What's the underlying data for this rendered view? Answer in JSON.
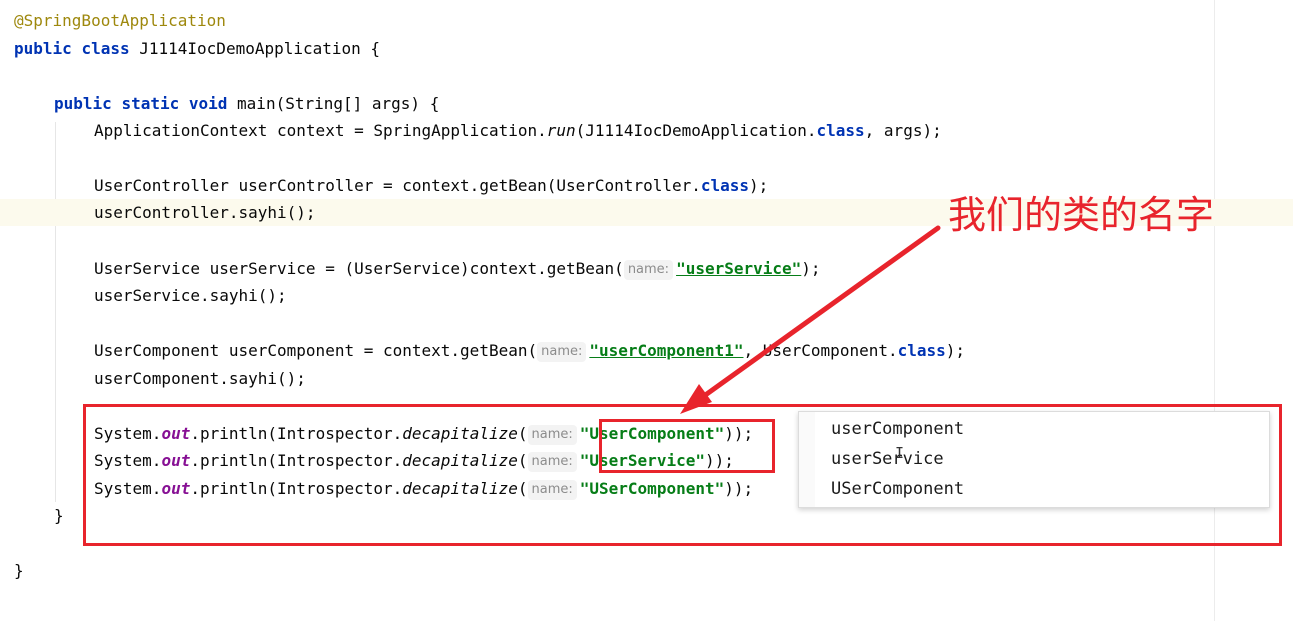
{
  "editor": {
    "lines": {
      "l1": {
        "annotation": "@SpringBootApplication"
      },
      "l2": {
        "kw1": "public",
        "kw2": "class",
        "rest": " J1114IocDemoApplication {"
      },
      "l4": {
        "kw1": "public",
        "kw2": "static",
        "kw3": "void",
        "rest": " main(String[] args) {"
      },
      "l5": {
        "p1": "ApplicationContext context = SpringApplication.",
        "method": "run",
        "p2": "(J1114IocDemoApplication.",
        "kw": "class",
        "p3": ", args);"
      },
      "l7": {
        "p1": "UserController userController = context.getBean(UserController.",
        "kw": "class",
        "p2": ");"
      },
      "l8": {
        "text": "userController.sayhi();"
      },
      "l10": {
        "p1": "UserService userService = (UserService)context.getBean(",
        "hint": "name:",
        "str": "\"userService\"",
        "p2": ");"
      },
      "l11": {
        "text": "userService.sayhi();"
      },
      "l13": {
        "p1": "UserComponent userComponent = context.getBean(",
        "hint": "name:",
        "str": "\"userComponent1\"",
        "p2": ", UserComponent.",
        "kw": "class",
        "p3": ");"
      },
      "l14": {
        "text": "userComponent.sayhi();"
      },
      "l16": {
        "p1": "System.",
        "field": "out",
        "p2": ".println(Introspector.",
        "method": "decapitalize",
        "p3": "(",
        "hint": "name:",
        "str": "\"UserComponent\"",
        "p4": "));"
      },
      "l17": {
        "p1": "System.",
        "field": "out",
        "p2": ".println(Introspector.",
        "method": "decapitalize",
        "p3": "(",
        "hint": "name:",
        "str": "\"UserService\"",
        "p4": "));"
      },
      "l18": {
        "p1": "System.",
        "field": "out",
        "p2": ".println(Introspector.",
        "method": "decapitalize",
        "p3": "(",
        "hint": "name:",
        "str": "\"USerComponent\"",
        "p4": "));"
      },
      "l19": {
        "text": "}"
      },
      "l21": {
        "text": "}"
      }
    }
  },
  "output_popup": {
    "items": [
      "userComponent",
      "userService",
      "USerComponent"
    ]
  },
  "callout": {
    "text": "我们的类的名字"
  },
  "colors": {
    "keyword": "#0033b3",
    "string": "#067d17",
    "annotation": "#9e880d",
    "static_field": "#871094",
    "highlight_red": "#e8242c"
  }
}
